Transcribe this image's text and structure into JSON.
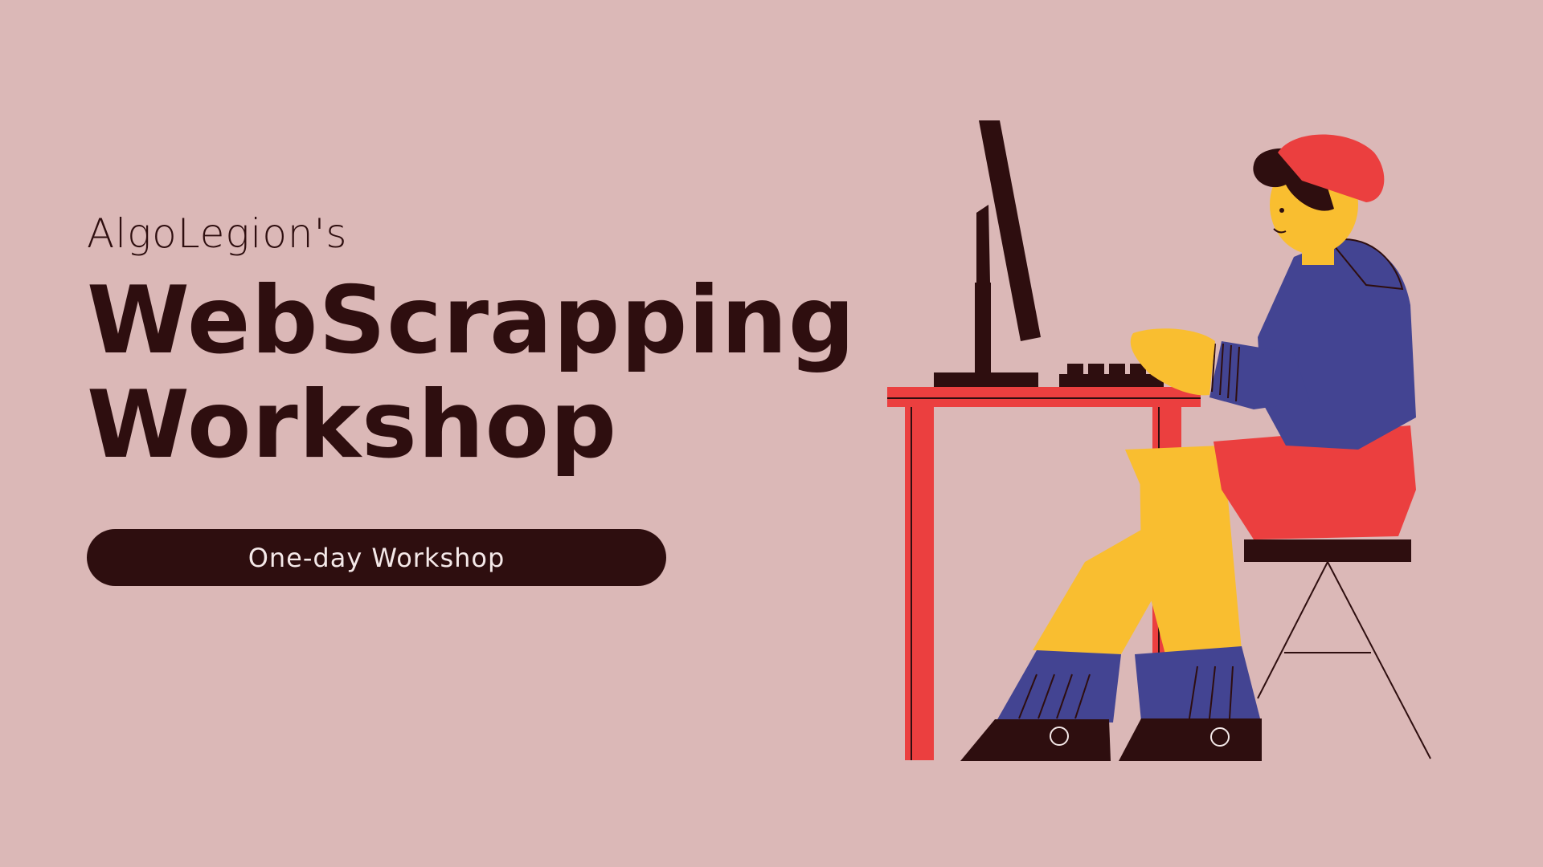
{
  "slide": {
    "subtitle": "AlgoLegion's",
    "title_line1": "WebScrapping",
    "title_line2": "Workshop",
    "badge": "One-day Workshop"
  },
  "illustration": {
    "icon": "person-at-computer-illustration",
    "colors": {
      "background": "#dbb8b7",
      "dark": "#2e0e0f",
      "red": "#eb3f3f",
      "yellow": "#f9be30",
      "blue": "#434492"
    }
  }
}
